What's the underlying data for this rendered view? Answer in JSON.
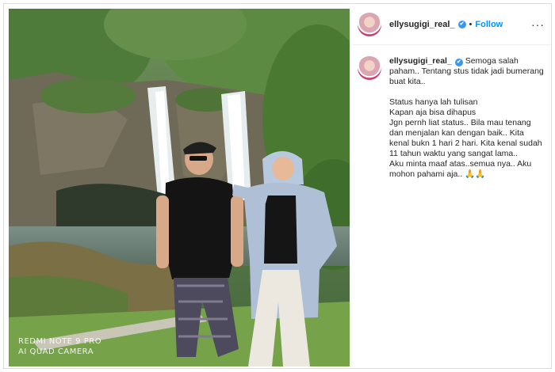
{
  "post": {
    "username": "ellysugigi_real_",
    "follow_label": "Follow",
    "separator": "•",
    "verified_mark": "✔",
    "more_label": "···",
    "caption_first": "Semoga salah paham.. Tentang stus tidak jadi bumerang buat kita..",
    "caption_rest": "\nStatus hanya lah tulisan\nKapan aja bisa dihapus\nJgn pernh liat status.. Bila mau tenang dan menjalan kan dengan baik.. Kita kenal bukn 1 hari 2 hari. Kita kenal sudah 11 tahun waktu yang sangat lama..\nAku minta maaf atas..semua nya.. Aku mohon pahami aja.. 🙏🙏"
  },
  "photo": {
    "watermark_line1": "REDMI NOTE 9 PRO",
    "watermark_line2": "AI QUAD CAMERA"
  },
  "colors": {
    "link_blue": "#0095f6",
    "verified_blue": "#3897f0"
  }
}
